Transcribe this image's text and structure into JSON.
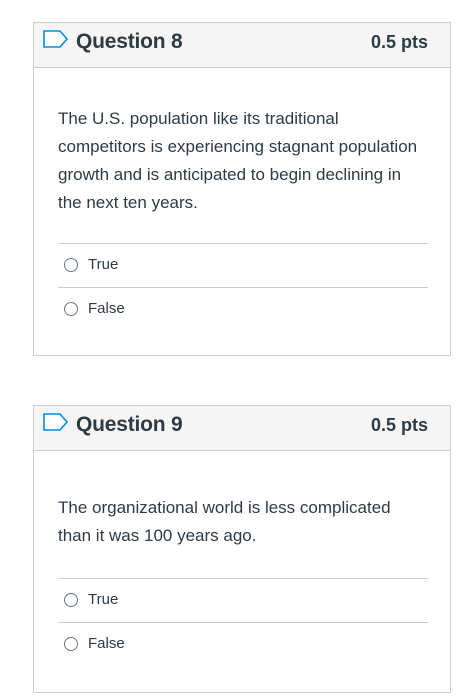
{
  "questions": [
    {
      "title": "Question 8",
      "points": "0.5 pts",
      "text": "The U.S. population like its traditional competitors is experiencing stagnant population growth and is anticipated to begin declining in the next ten years.",
      "answers": [
        "True",
        "False"
      ]
    },
    {
      "title": "Question 9",
      "points": "0.5 pts",
      "text": "The organizational world is less complicated than it was 100 years ago.",
      "answers": [
        "True",
        "False"
      ]
    }
  ],
  "colors": {
    "text": "#2d3b45",
    "border": "#c7cdd1",
    "header_bg": "#f5f5f5"
  },
  "icons": {
    "flag": "flag-outline-icon",
    "radio": "radio-unchecked"
  }
}
